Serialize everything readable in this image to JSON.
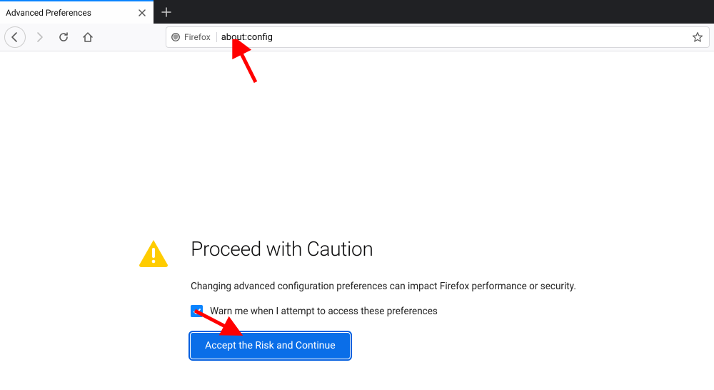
{
  "tab": {
    "title": "Advanced Preferences"
  },
  "url_bar": {
    "identity_label": "Firefox",
    "url_text": "about:config"
  },
  "warning": {
    "heading": "Proceed with Caution",
    "body_text": "Changing advanced configuration preferences can impact Firefox performance or security.",
    "checkbox_label": "Warn me when I attempt to access these preferences",
    "accept_button_label": "Accept the Risk and Continue"
  }
}
